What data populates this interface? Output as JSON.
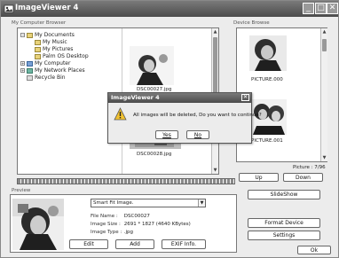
{
  "window": {
    "title": "ImageViewer 4",
    "controls": {
      "minimize": "_",
      "restore": "□",
      "close": "✕"
    }
  },
  "computer_browser": {
    "label": "My Computer Browser",
    "tree": [
      {
        "label": "My Documents",
        "expander": "−",
        "icon": "folder-icon"
      },
      {
        "label": "My Music",
        "icon": "folder-icon"
      },
      {
        "label": "My Pictures",
        "icon": "folder-icon"
      },
      {
        "label": "Palm OS Desktop",
        "icon": "folder-icon"
      },
      {
        "label": "My Computer",
        "expander": "+",
        "icon": "computer-icon"
      },
      {
        "label": "My Network Places",
        "expander": "+",
        "icon": "network-icon"
      },
      {
        "label": "Recycle Bin",
        "icon": "recycle-bin-icon"
      }
    ],
    "thumbnails": [
      {
        "filename": "DSC00027.jpg"
      },
      {
        "filename": "DSC00028.jpg"
      }
    ]
  },
  "device_browse": {
    "label": "Device Browse",
    "items": [
      {
        "filename": "PICTURE.000"
      },
      {
        "filename": "PICTURE.001"
      }
    ],
    "picture_count": "Picture : 7/96",
    "up_label": "Up",
    "down_label": "Down"
  },
  "dialog": {
    "title": "ImageViewer 4",
    "close": "✕",
    "message": "All images will be deleted, Do you want to continue?",
    "yes_label": "Yes",
    "no_label": "No"
  },
  "preview": {
    "label": "Preview",
    "fit_mode": "Smart Fit Image.",
    "file_name_label": "File Name :",
    "file_name": "DSC00027",
    "image_size_label": "Image Size :",
    "image_size": "2691 * 1827 (4640 KBytes)",
    "image_type_label": "Image Type :",
    "image_type": ".jpg",
    "edit_label": "Edit",
    "add_label": "Add",
    "exif_label": "EXIF Info."
  },
  "actions": {
    "slideshow_label": "SlideShow",
    "format_device_label": "Format Device",
    "settings_label": "Settings",
    "ok_label": "Ok"
  },
  "colors": {
    "titlebar": "#555555",
    "window_bg": "#ececec",
    "warning": "#f2c230"
  }
}
